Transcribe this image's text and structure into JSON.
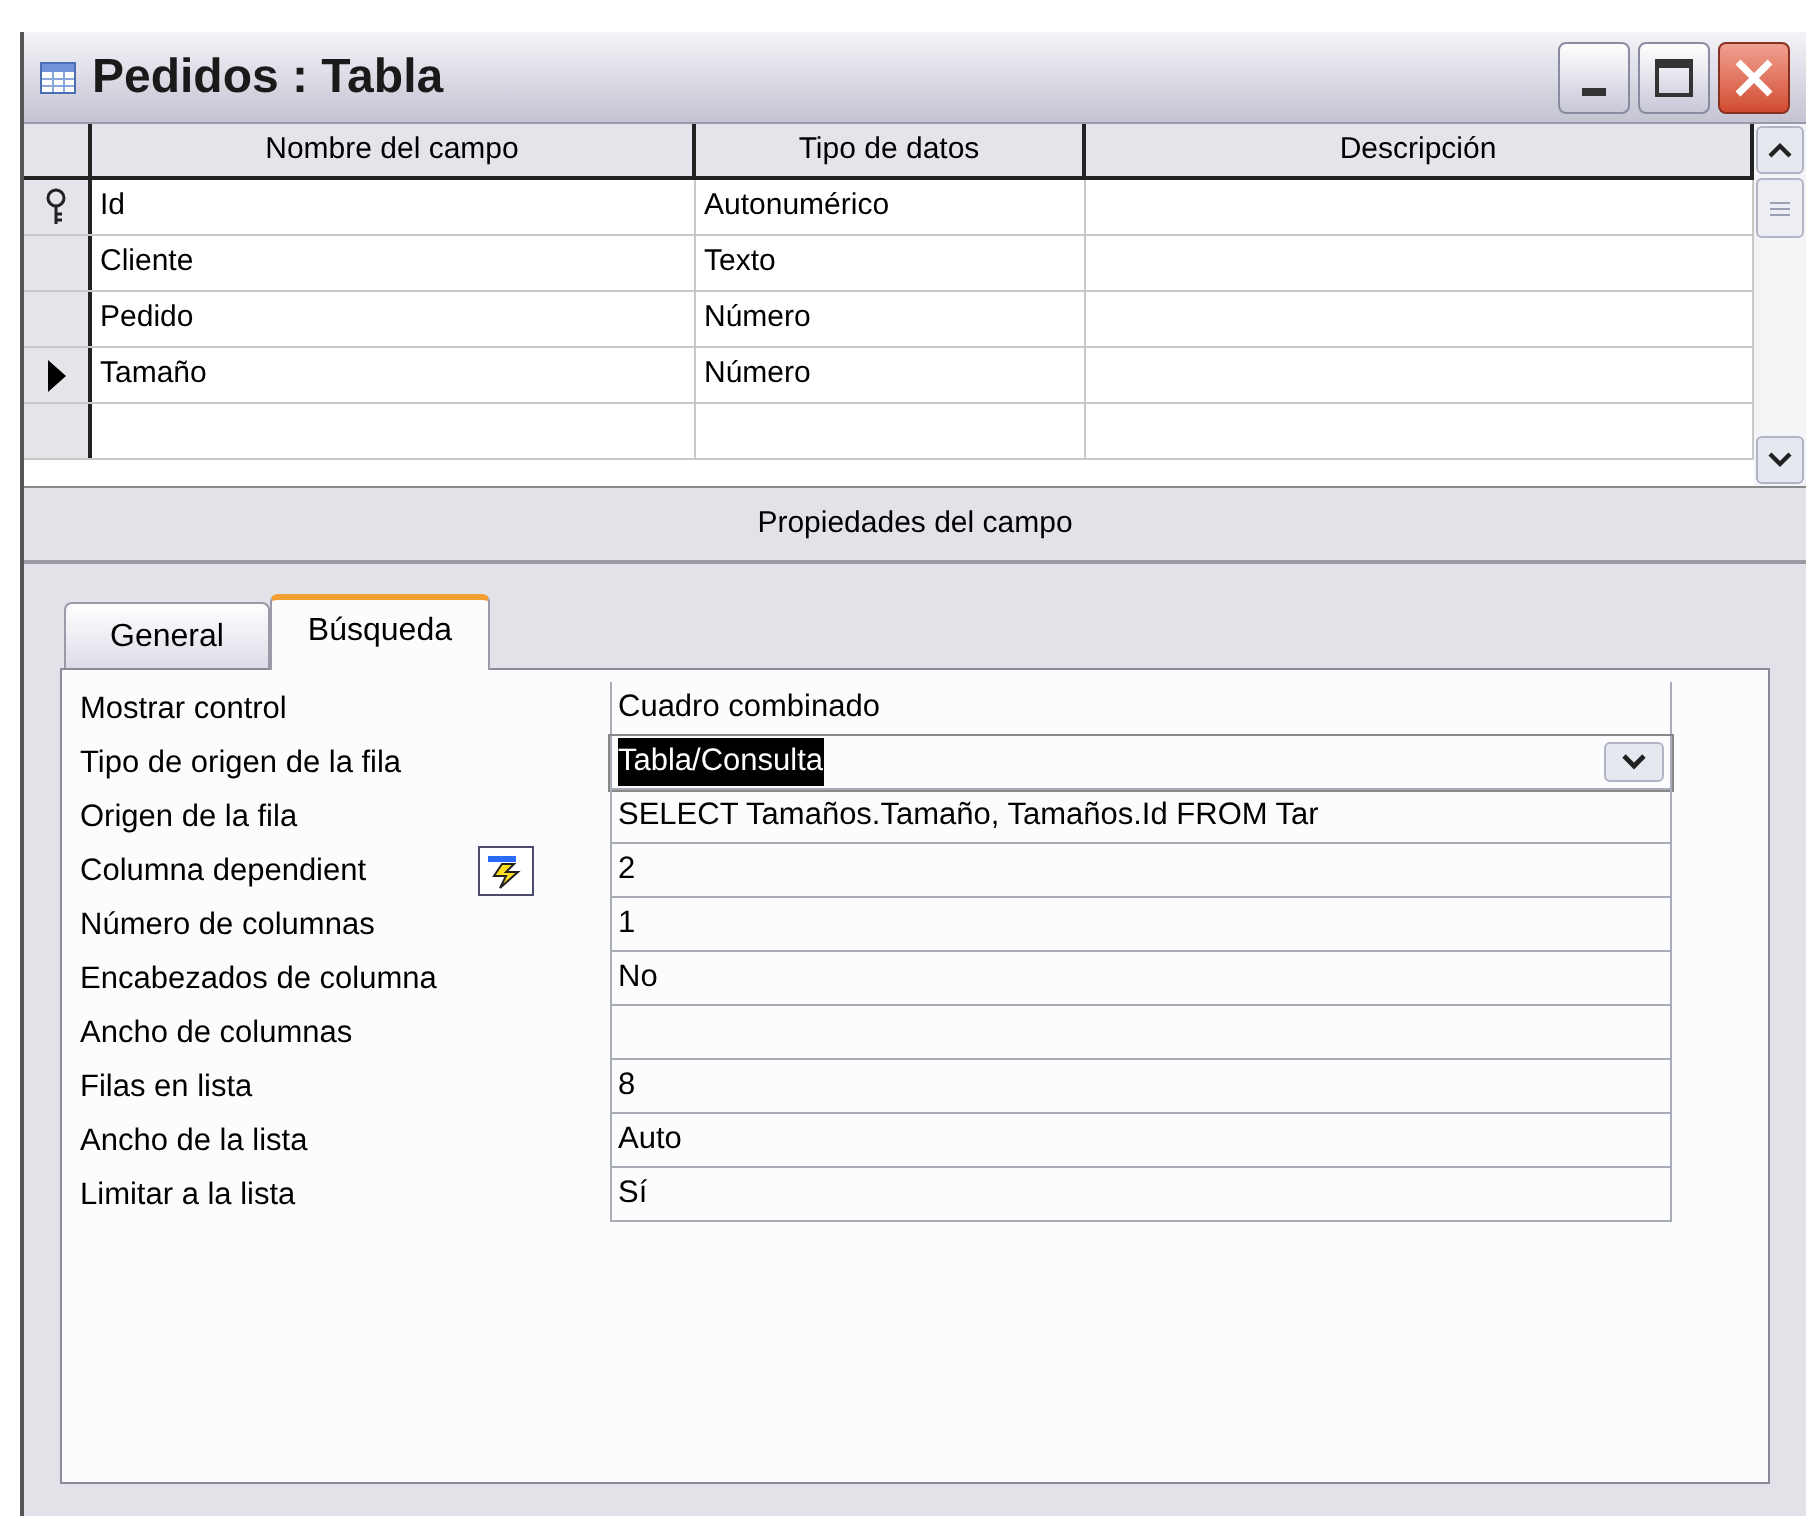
{
  "window": {
    "title": "Pedidos : Tabla"
  },
  "table": {
    "columns": [
      "Nombre del campo",
      "Tipo de datos",
      "Descripción"
    ],
    "rows": [
      {
        "name": "Id",
        "type": "Autonumérico",
        "primary_key": true,
        "current": false
      },
      {
        "name": "Cliente",
        "type": "Texto",
        "primary_key": false,
        "current": false
      },
      {
        "name": "Pedido",
        "type": "Número",
        "primary_key": false,
        "current": false
      },
      {
        "name": "Tamaño",
        "type": "Número",
        "primary_key": false,
        "current": true
      }
    ]
  },
  "section_title": "Propiedades del campo",
  "tabs": [
    {
      "label": "General",
      "selected": false
    },
    {
      "label": "Búsqueda",
      "selected": true
    }
  ],
  "properties": [
    {
      "label": "Mostrar control",
      "value": "Cuadro combinado",
      "kind": "text",
      "highlighted": false,
      "builder": false
    },
    {
      "label": "Tipo de origen de la fila",
      "value": "Tabla/Consulta",
      "kind": "combo",
      "highlighted": true,
      "builder": false
    },
    {
      "label": "Origen de la fila",
      "value": "SELECT Tamaños.Tamaño, Tamaños.Id FROM Tar",
      "kind": "text",
      "highlighted": false,
      "builder": false
    },
    {
      "label": "Columna dependient",
      "value": "2",
      "kind": "text",
      "highlighted": false,
      "builder": true
    },
    {
      "label": "Número de columnas",
      "value": "1",
      "kind": "text",
      "highlighted": false,
      "builder": false
    },
    {
      "label": "Encabezados de columna",
      "value": "No",
      "kind": "text",
      "highlighted": false,
      "builder": false
    },
    {
      "label": "Ancho de columnas",
      "kind": "text",
      "highlighted": false,
      "builder": false
    },
    {
      "label": "Filas en lista",
      "value": "8",
      "kind": "text",
      "highlighted": false,
      "builder": false
    },
    {
      "label": "Ancho de la lista",
      "value": "Auto",
      "kind": "text",
      "highlighted": false,
      "builder": false
    },
    {
      "label": "Limitar a la lista",
      "value": "Sí",
      "kind": "text",
      "highlighted": false,
      "builder": false
    }
  ]
}
